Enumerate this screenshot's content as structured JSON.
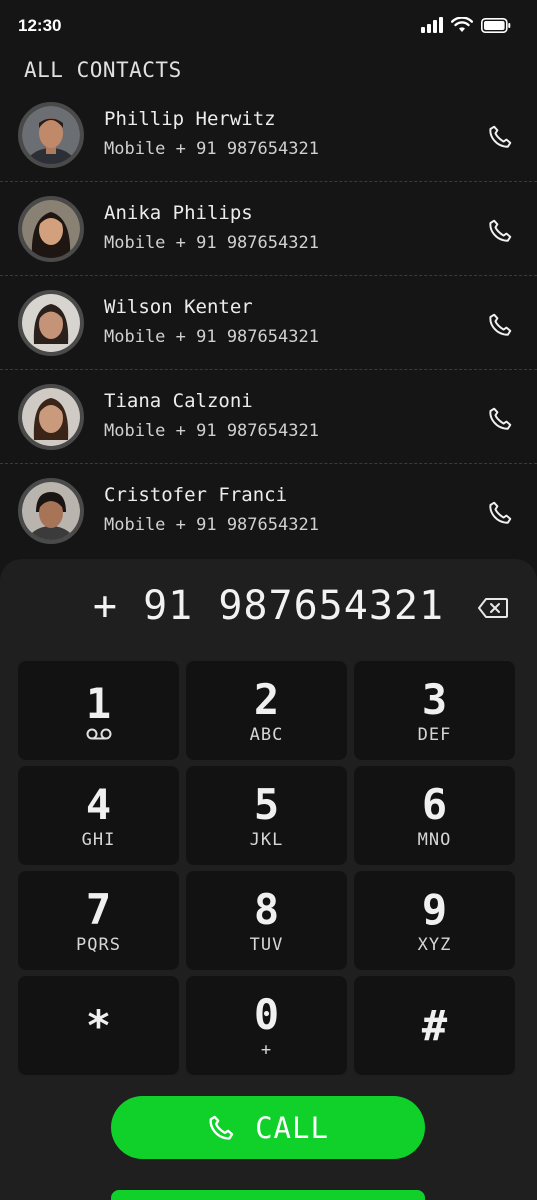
{
  "status_bar": {
    "time": "12:30"
  },
  "section_title": "ALL CONTACTS",
  "contacts": [
    {
      "name": "Phillip Herwitz",
      "number": "Mobile + 91 987654321"
    },
    {
      "name": "Anika Philips",
      "number": "Mobile + 91 987654321"
    },
    {
      "name": "Wilson Kenter",
      "number": "Mobile + 91 987654321"
    },
    {
      "name": "Tiana Calzoni",
      "number": "Mobile + 91 987654321"
    },
    {
      "name": "Cristofer Franci",
      "number": "Mobile + 91 987654321"
    }
  ],
  "dialer": {
    "number": "+ 91 987654321",
    "keys": [
      {
        "digit": "1",
        "letters": ""
      },
      {
        "digit": "2",
        "letters": "ABC"
      },
      {
        "digit": "3",
        "letters": "DEF"
      },
      {
        "digit": "4",
        "letters": "GHI"
      },
      {
        "digit": "5",
        "letters": "JKL"
      },
      {
        "digit": "6",
        "letters": "MNO"
      },
      {
        "digit": "7",
        "letters": "PQRS"
      },
      {
        "digit": "8",
        "letters": "TUV"
      },
      {
        "digit": "9",
        "letters": "XYZ"
      },
      {
        "digit": "*",
        "letters": ""
      },
      {
        "digit": "0",
        "letters": "+"
      },
      {
        "digit": "#",
        "letters": ""
      }
    ],
    "call_label": "CALL"
  },
  "colors": {
    "accent": "#0fd129",
    "background": "#151515",
    "panel": "#1f1f1f",
    "key": "#121212"
  }
}
